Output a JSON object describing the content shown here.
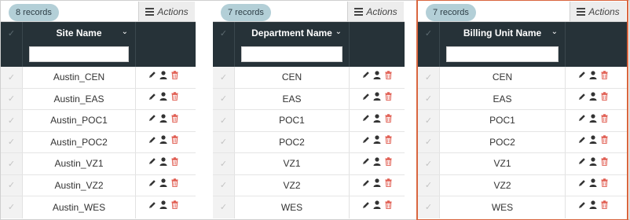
{
  "actions_label": "Actions",
  "grids": [
    {
      "records": "8 records",
      "column": "Site Name",
      "filter_value": "",
      "selected": false,
      "rows": [
        "Austin_CEN",
        "Austin_EAS",
        "Austin_POC1",
        "Austin_POC2",
        "Austin_VZ1",
        "Austin_VZ2",
        "Austin_WES"
      ]
    },
    {
      "records": "7 records",
      "column": "Department Name",
      "filter_value": "",
      "selected": false,
      "rows": [
        "CEN",
        "EAS",
        "POC1",
        "POC2",
        "VZ1",
        "VZ2",
        "WES"
      ]
    },
    {
      "records": "7 records",
      "column": "Billing Unit Name",
      "filter_value": "",
      "selected": true,
      "rows": [
        "CEN",
        "EAS",
        "POC1",
        "POC2",
        "VZ1",
        "VZ2",
        "WES"
      ]
    }
  ],
  "colors": {
    "header_bg": "#263238",
    "badge_bg": "#b3cfd7",
    "selection_outline": "#d9663f",
    "delete_icon": "#e05b4f"
  },
  "icons": [
    "check-icon",
    "sort-caret-icon",
    "menu-icon",
    "edit-pencil-icon",
    "user-icon",
    "trash-icon"
  ]
}
